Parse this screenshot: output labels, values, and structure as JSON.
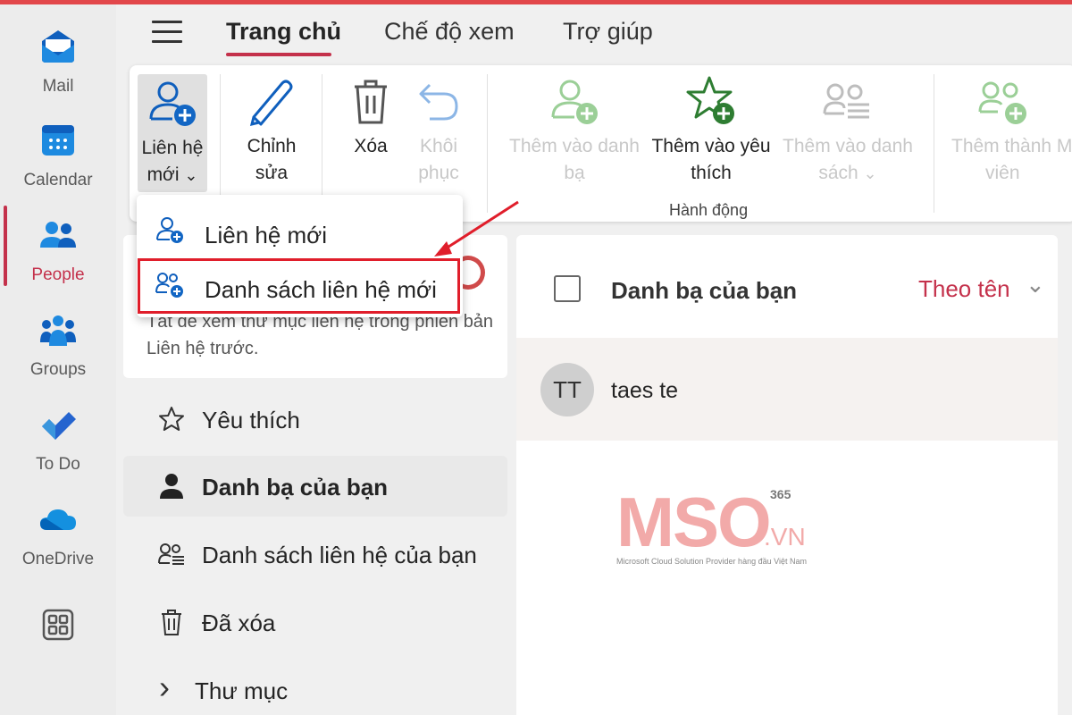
{
  "colors": {
    "accent": "#c4314b",
    "highlight_box": "#e01e2b",
    "logo": "#f2aaa9"
  },
  "rail": {
    "items": [
      {
        "label": "Mail",
        "icon": "mail-icon"
      },
      {
        "label": "Calendar",
        "icon": "calendar-icon"
      },
      {
        "label": "People",
        "icon": "people-icon",
        "active": true
      },
      {
        "label": "Groups",
        "icon": "groups-icon"
      },
      {
        "label": "To Do",
        "icon": "todo-icon"
      },
      {
        "label": "OneDrive",
        "icon": "onedrive-icon"
      },
      {
        "label": "",
        "icon": "apps-icon"
      }
    ]
  },
  "tabs": [
    {
      "label": "Trang chủ",
      "active": true
    },
    {
      "label": "Chế độ xem"
    },
    {
      "label": "Trợ giúp"
    }
  ],
  "ribbon": {
    "new_contact": {
      "line1": "Liên hệ",
      "line2": "mới",
      "chevron": "⌄"
    },
    "edit": {
      "line1": "Chỉnh",
      "line2": "sửa"
    },
    "delete": {
      "line1": "Xóa"
    },
    "restore": {
      "line1": "Khôi",
      "line2": "phục"
    },
    "add_to_contacts": {
      "line1": "Thêm vào danh",
      "line2": "bạ"
    },
    "add_to_favorites": {
      "line1": "Thêm vào yêu",
      "line2": "thích"
    },
    "add_to_list": {
      "line1": "Thêm vào danh",
      "line2": "sách",
      "chevron": "⌄"
    },
    "add_member": {
      "line1": "Thêm thành M",
      "line2": "viên"
    },
    "group_label": "Hành động"
  },
  "dropdown": {
    "items": [
      {
        "label": "Liên hệ mới",
        "icon": "person-add-icon"
      },
      {
        "label": "Danh sách liên hệ mới",
        "icon": "people-list-add-icon"
      }
    ]
  },
  "notice": {
    "text": "Tắt để xem thư mục liên hệ trong phiên bản Liên hệ trước."
  },
  "folders": [
    {
      "label": "Yêu thích",
      "icon": "star-icon"
    },
    {
      "label": "Danh bạ của bạn",
      "icon": "person-icon",
      "active": true
    },
    {
      "label": "Danh sách liên hệ của bạn",
      "icon": "contact-list-icon"
    },
    {
      "label": "Đã xóa",
      "icon": "trash-icon"
    },
    {
      "label": "Thư mục",
      "icon": "chevron-right-icon",
      "chevron": "›"
    }
  ],
  "list": {
    "title": "Danh bạ của bạn",
    "sort_label": "Theo tên",
    "sort_chevron": "⌄",
    "contacts": [
      {
        "initials": "TT",
        "name": "taes te"
      }
    ]
  },
  "logo": {
    "main": "MSO",
    "vn": ".VN",
    "badge": "365",
    "tagline": "Microsoft Cloud Solution Provider hàng đầu Việt Nam"
  }
}
